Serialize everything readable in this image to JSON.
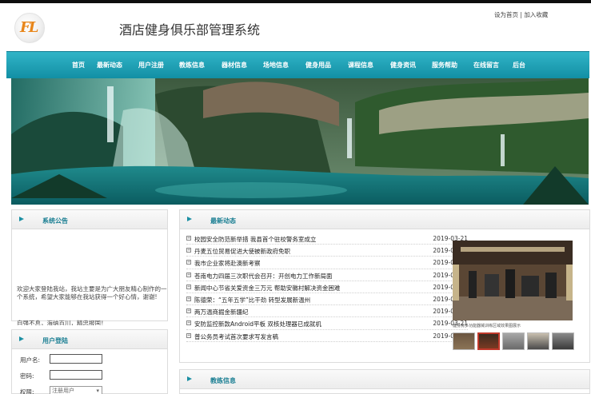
{
  "header": {
    "site_title": "酒店健身俱乐部管理系统",
    "logo_text": "FL",
    "set_home": "设为首页",
    "separator": "|",
    "add_favorite": "加入收藏"
  },
  "nav": {
    "items": [
      "首页",
      "最新动态",
      "用户注册",
      "教练信息",
      "器材信息",
      "场地信息",
      "健身用品",
      "课程信息",
      "健身资讯",
      "服务帮助",
      "在线留言",
      "后台"
    ]
  },
  "notice": {
    "title": "系统公告",
    "text": "欢迎大家登陆我站，我站主要是为广大朋友精心制作的一个系统，希望大家能够在我站获得一个好心情，谢谢!",
    "more": "自强不息，海纳百川，精忠报国！"
  },
  "login": {
    "title": "用户登陆",
    "username_label": "用户名:",
    "password_label": "密码:",
    "role_label": "权限:",
    "role_value": "注册用户"
  },
  "news": {
    "title": "最新动态",
    "items": [
      {
        "title": "校园安全防范新举措 我县首个驻校警务室成立",
        "date": "2019-03-21"
      },
      {
        "title": "丹麦五位贸易促进大使被新政府免职",
        "date": "2019-03-21"
      },
      {
        "title": "我市企业家将赴澳新考察",
        "date": "2019-03-21"
      },
      {
        "title": "苍南电力四届三次职代会召开：开创电力工作新局面",
        "date": "2019-03-21"
      },
      {
        "title": "新闻中心节省关爱资金三万元 帮助安徽村解决资金困难",
        "date": "2019-03-21"
      },
      {
        "title": "陈德荣：“五年五学”比干劲 转型发展新温州",
        "date": "2019-03-21"
      },
      {
        "title": "两万温商掘金新疆纪",
        "date": "2019-03-21"
      },
      {
        "title": "安防监控新款Android平板 双核处理器已成就机",
        "date": "2019-03-21"
      },
      {
        "title": "普公务员考试首次要求写发言稿",
        "date": "2019-03-21"
      }
    ],
    "photo_caption": "健身房多功能器械训练区域效果图展示"
  },
  "coach": {
    "title": "教练信息"
  },
  "colors": {
    "nav_top": "#31b4c7",
    "nav_bottom": "#128fa4",
    "panel_title": "#1b7f93",
    "logo": "#e8861a"
  }
}
